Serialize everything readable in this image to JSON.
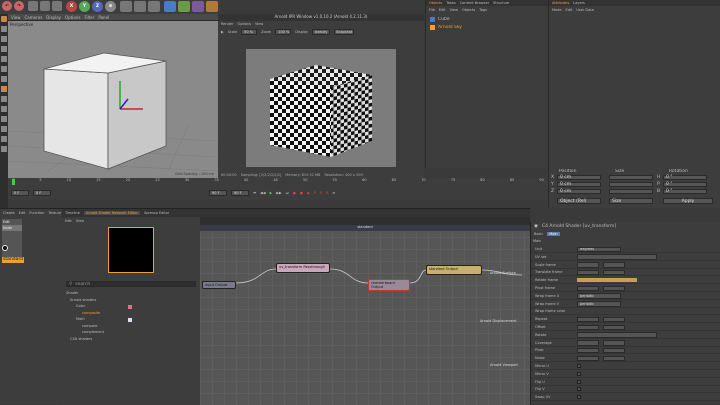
{
  "toolbar": {
    "undo": "↶",
    "redo": "↷",
    "x": "X",
    "y": "Y",
    "z": "Z",
    "globe": "⊕"
  },
  "viewport": {
    "menu": [
      "View",
      "Cameras",
      "Display",
      "Options",
      "Filter",
      "Panel"
    ],
    "name": "Perspective",
    "grid": "Grid Spacing : 100 cm"
  },
  "ipr": {
    "title": "Arnold IPR Window v1.0.10.2 (Arnold 4.2.11.3)",
    "menu": [
      "Render",
      "Options",
      "View"
    ],
    "scale_label": "Scale",
    "scale_value": "50 %",
    "zoom_label": "Zoom",
    "zoom_value": "100 %",
    "display_label": "Display",
    "display_value": "beauty",
    "snapshot": "Snapshot",
    "time": "00:00:00",
    "sampling": "Sampling: [2/2/2/2/2/2]",
    "memory": "Memory: 819.52 MB",
    "resolution": "Resolution: 400 x 300"
  },
  "objects": {
    "tabs": [
      "Objects",
      "Takes",
      "Content Browser",
      "Structure"
    ],
    "menu": [
      "File",
      "Edit",
      "View",
      "Objects",
      "Tags"
    ],
    "items": [
      {
        "name": "Cube"
      },
      {
        "name": "Arnold Sky"
      }
    ]
  },
  "attributes": {
    "tabs": [
      "Attributes",
      "Layers"
    ],
    "menu": [
      "Mode",
      "Edit",
      "User Data"
    ]
  },
  "coords": {
    "headers": [
      "Position",
      "Size",
      "Rotation"
    ],
    "rows": [
      {
        "axis": "X",
        "pos": "0 cm",
        "rot_axis": "H",
        "rot": "0 °"
      },
      {
        "axis": "Y",
        "pos": "0 cm",
        "rot_axis": "P",
        "rot": "0 °"
      },
      {
        "axis": "Z",
        "pos": "0 cm",
        "rot_axis": "B",
        "rot": "0 °"
      }
    ],
    "mode1": "Object (Rel)",
    "mode2": "Size",
    "apply": "Apply"
  },
  "timeline": {
    "ticks": [
      "0",
      "5",
      "10",
      "15",
      "20",
      "25",
      "30",
      "35",
      "40",
      "45",
      "50",
      "55",
      "60",
      "65",
      "70",
      "75",
      "80",
      "85",
      "90"
    ],
    "start": "0 F",
    "current": "0 F",
    "end": "90 F",
    "end2": "90 F",
    "frame": "0 F"
  },
  "material": {
    "menu": [
      "Create",
      "Edit",
      "Function",
      "Texture"
    ],
    "tabs": [
      "Timeline",
      "Arnold Shader Network Editor",
      "Xpresso Editor"
    ],
    "item": "standard",
    "sub": [
      "Edit",
      "Node"
    ]
  },
  "shader_editor": {
    "menu": [
      "Edit",
      "View"
    ],
    "search_placeholder": "search",
    "tree": [
      {
        "label": "Shader",
        "indent": 0
      },
      {
        "label": "Arnold shaders",
        "indent": 1
      },
      {
        "label": "Color",
        "indent": 2
      },
      {
        "label": "composite",
        "indent": 3,
        "selected": true
      },
      {
        "label": "Math",
        "indent": 2
      },
      {
        "label": "compare",
        "indent": 3
      },
      {
        "label": "complement",
        "indent": 3
      },
      {
        "label": "C4D shaders",
        "indent": 1
      }
    ],
    "graph_title": "standard",
    "nodes": [
      {
        "label": "uv_transform",
        "body": "Passthrough"
      },
      {
        "label": "checkerboard",
        "body": "Output"
      },
      {
        "label": "standard",
        "body": "Output"
      },
      {
        "label": "Arnold Surface",
        "body": "Shader"
      },
      {
        "label": "input",
        "body": "Output"
      }
    ],
    "ports": [
      "Arnold Surface",
      "Arnold Displacement",
      "Arnold Viewport"
    ]
  },
  "attr_panel": {
    "title": "C4 Arnold Shader [uv_transform]",
    "tabs": [
      "Basic",
      "Main"
    ],
    "section": "Main",
    "rows": [
      {
        "label": "Unit",
        "value": "degrees",
        "type": "select"
      },
      {
        "label": "UV set",
        "value": "",
        "type": "field"
      },
      {
        "label": "Scale frame",
        "value": "",
        "type": "dual"
      },
      {
        "label": "Translate frame",
        "value": "",
        "type": "dual"
      },
      {
        "label": "Rotate frame",
        "value": "",
        "type": "bar"
      },
      {
        "label": "Pivot frame",
        "value": "",
        "type": "dual"
      },
      {
        "label": "Wrap frame U",
        "value": "periodic",
        "type": "select"
      },
      {
        "label": "Wrap frame V",
        "value": "periodic",
        "type": "select"
      },
      {
        "label": "Wrap frame color",
        "value": "",
        "type": "none"
      },
      {
        "label": "Repeat",
        "value": "",
        "type": "dual"
      },
      {
        "label": "Offset",
        "value": "",
        "type": "dual"
      },
      {
        "label": "Rotate",
        "value": "",
        "type": "field"
      },
      {
        "label": "Coverage",
        "value": "",
        "type": "dual"
      },
      {
        "label": "Pivot",
        "value": "",
        "type": "dual"
      },
      {
        "label": "Noise",
        "value": "",
        "type": "dual"
      },
      {
        "label": "Mirror U",
        "value": "",
        "type": "check"
      },
      {
        "label": "Mirror V",
        "value": "",
        "type": "check"
      },
      {
        "label": "Flip U",
        "value": "",
        "type": "check"
      },
      {
        "label": "Flip V",
        "value": "",
        "type": "check"
      },
      {
        "label": "Swap UV",
        "value": "",
        "type": "check"
      }
    ]
  }
}
